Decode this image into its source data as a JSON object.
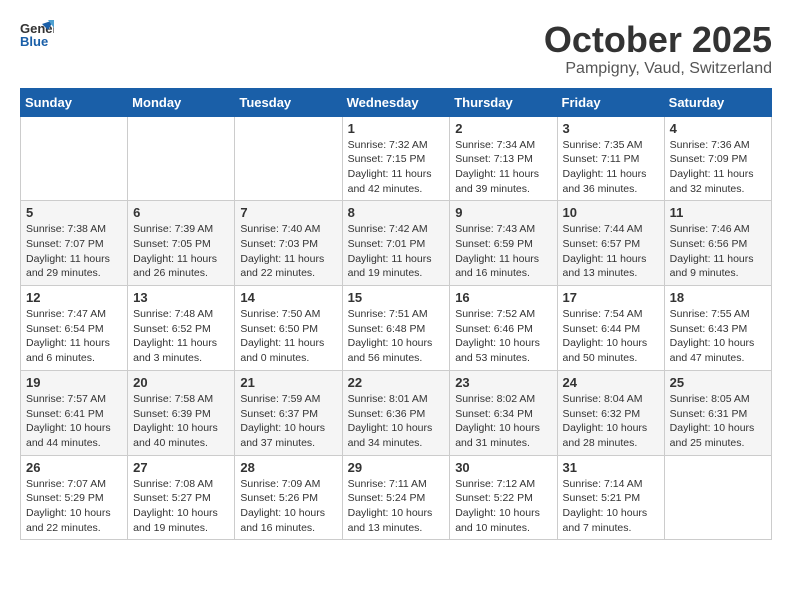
{
  "header": {
    "logo": {
      "general": "General",
      "blue": "Blue"
    },
    "title": "October 2025",
    "subtitle": "Pampigny, Vaud, Switzerland"
  },
  "weekdays": [
    "Sunday",
    "Monday",
    "Tuesday",
    "Wednesday",
    "Thursday",
    "Friday",
    "Saturday"
  ],
  "weeks": [
    [
      {
        "day": "",
        "info": ""
      },
      {
        "day": "",
        "info": ""
      },
      {
        "day": "",
        "info": ""
      },
      {
        "day": "1",
        "info": "Sunrise: 7:32 AM\nSunset: 7:15 PM\nDaylight: 11 hours\nand 42 minutes."
      },
      {
        "day": "2",
        "info": "Sunrise: 7:34 AM\nSunset: 7:13 PM\nDaylight: 11 hours\nand 39 minutes."
      },
      {
        "day": "3",
        "info": "Sunrise: 7:35 AM\nSunset: 7:11 PM\nDaylight: 11 hours\nand 36 minutes."
      },
      {
        "day": "4",
        "info": "Sunrise: 7:36 AM\nSunset: 7:09 PM\nDaylight: 11 hours\nand 32 minutes."
      }
    ],
    [
      {
        "day": "5",
        "info": "Sunrise: 7:38 AM\nSunset: 7:07 PM\nDaylight: 11 hours\nand 29 minutes."
      },
      {
        "day": "6",
        "info": "Sunrise: 7:39 AM\nSunset: 7:05 PM\nDaylight: 11 hours\nand 26 minutes."
      },
      {
        "day": "7",
        "info": "Sunrise: 7:40 AM\nSunset: 7:03 PM\nDaylight: 11 hours\nand 22 minutes."
      },
      {
        "day": "8",
        "info": "Sunrise: 7:42 AM\nSunset: 7:01 PM\nDaylight: 11 hours\nand 19 minutes."
      },
      {
        "day": "9",
        "info": "Sunrise: 7:43 AM\nSunset: 6:59 PM\nDaylight: 11 hours\nand 16 minutes."
      },
      {
        "day": "10",
        "info": "Sunrise: 7:44 AM\nSunset: 6:57 PM\nDaylight: 11 hours\nand 13 minutes."
      },
      {
        "day": "11",
        "info": "Sunrise: 7:46 AM\nSunset: 6:56 PM\nDaylight: 11 hours\nand 9 minutes."
      }
    ],
    [
      {
        "day": "12",
        "info": "Sunrise: 7:47 AM\nSunset: 6:54 PM\nDaylight: 11 hours\nand 6 minutes."
      },
      {
        "day": "13",
        "info": "Sunrise: 7:48 AM\nSunset: 6:52 PM\nDaylight: 11 hours\nand 3 minutes."
      },
      {
        "day": "14",
        "info": "Sunrise: 7:50 AM\nSunset: 6:50 PM\nDaylight: 11 hours\nand 0 minutes."
      },
      {
        "day": "15",
        "info": "Sunrise: 7:51 AM\nSunset: 6:48 PM\nDaylight: 10 hours\nand 56 minutes."
      },
      {
        "day": "16",
        "info": "Sunrise: 7:52 AM\nSunset: 6:46 PM\nDaylight: 10 hours\nand 53 minutes."
      },
      {
        "day": "17",
        "info": "Sunrise: 7:54 AM\nSunset: 6:44 PM\nDaylight: 10 hours\nand 50 minutes."
      },
      {
        "day": "18",
        "info": "Sunrise: 7:55 AM\nSunset: 6:43 PM\nDaylight: 10 hours\nand 47 minutes."
      }
    ],
    [
      {
        "day": "19",
        "info": "Sunrise: 7:57 AM\nSunset: 6:41 PM\nDaylight: 10 hours\nand 44 minutes."
      },
      {
        "day": "20",
        "info": "Sunrise: 7:58 AM\nSunset: 6:39 PM\nDaylight: 10 hours\nand 40 minutes."
      },
      {
        "day": "21",
        "info": "Sunrise: 7:59 AM\nSunset: 6:37 PM\nDaylight: 10 hours\nand 37 minutes."
      },
      {
        "day": "22",
        "info": "Sunrise: 8:01 AM\nSunset: 6:36 PM\nDaylight: 10 hours\nand 34 minutes."
      },
      {
        "day": "23",
        "info": "Sunrise: 8:02 AM\nSunset: 6:34 PM\nDaylight: 10 hours\nand 31 minutes."
      },
      {
        "day": "24",
        "info": "Sunrise: 8:04 AM\nSunset: 6:32 PM\nDaylight: 10 hours\nand 28 minutes."
      },
      {
        "day": "25",
        "info": "Sunrise: 8:05 AM\nSunset: 6:31 PM\nDaylight: 10 hours\nand 25 minutes."
      }
    ],
    [
      {
        "day": "26",
        "info": "Sunrise: 7:07 AM\nSunset: 5:29 PM\nDaylight: 10 hours\nand 22 minutes."
      },
      {
        "day": "27",
        "info": "Sunrise: 7:08 AM\nSunset: 5:27 PM\nDaylight: 10 hours\nand 19 minutes."
      },
      {
        "day": "28",
        "info": "Sunrise: 7:09 AM\nSunset: 5:26 PM\nDaylight: 10 hours\nand 16 minutes."
      },
      {
        "day": "29",
        "info": "Sunrise: 7:11 AM\nSunset: 5:24 PM\nDaylight: 10 hours\nand 13 minutes."
      },
      {
        "day": "30",
        "info": "Sunrise: 7:12 AM\nSunset: 5:22 PM\nDaylight: 10 hours\nand 10 minutes."
      },
      {
        "day": "31",
        "info": "Sunrise: 7:14 AM\nSunset: 5:21 PM\nDaylight: 10 hours\nand 7 minutes."
      },
      {
        "day": "",
        "info": ""
      }
    ]
  ]
}
